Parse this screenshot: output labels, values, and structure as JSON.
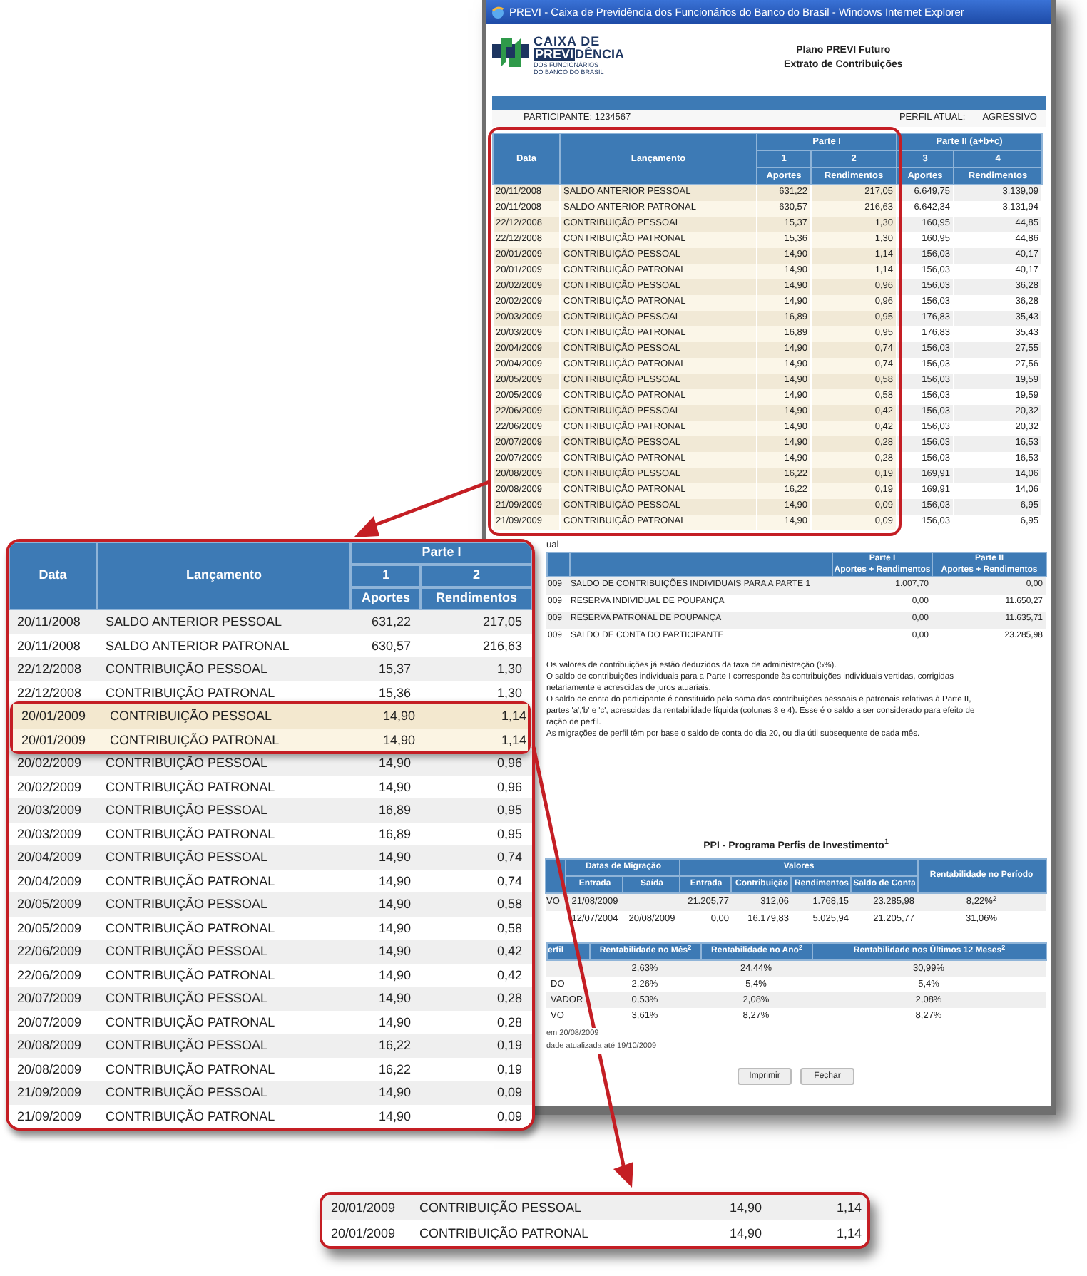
{
  "window": {
    "title": "PREVI - Caixa de Previdência dos Funcionários do Banco do Brasil - Windows Internet Explorer",
    "logo": {
      "line1": "CAIXA DE",
      "boxed": "PREVI",
      "rest": "DÊNCIA",
      "line3": "DOS FUNCIONÁRIOS",
      "line4": "DO BANCO DO BRASIL"
    },
    "heading": [
      "Plano PREVI Futuro",
      "Extrato de Contribuições"
    ],
    "participant": "PARTICIPANTE: 1234567",
    "profile_label": "PERFIL ATUAL:",
    "profile_value": "AGRESSIVO",
    "statement": {
      "headers": {
        "date": "Data",
        "entry": "Lançamento",
        "groups": [
          "Parte I",
          "Parte II (a+b+c)"
        ],
        "numbers": [
          "1",
          "2",
          "3",
          "4"
        ],
        "subs": [
          "Aportes",
          "Rendimentos",
          "Aportes",
          "Rendimentos"
        ]
      },
      "rows": [
        [
          "20/11/2008",
          "SALDO ANTERIOR PESSOAL",
          "631,22",
          "217,05",
          "6.649,75",
          "3.139,09"
        ],
        [
          "20/11/2008",
          "SALDO ANTERIOR PATRONAL",
          "630,57",
          "216,63",
          "6.642,34",
          "3.131,94"
        ],
        [
          "22/12/2008",
          "CONTRIBUIÇÃO PESSOAL",
          "15,37",
          "1,30",
          "160,95",
          "44,85"
        ],
        [
          "22/12/2008",
          "CONTRIBUIÇÃO PATRONAL",
          "15,36",
          "1,30",
          "160,95",
          "44,86"
        ],
        [
          "20/01/2009",
          "CONTRIBUIÇÃO PESSOAL",
          "14,90",
          "1,14",
          "156,03",
          "40,17"
        ],
        [
          "20/01/2009",
          "CONTRIBUIÇÃO PATRONAL",
          "14,90",
          "1,14",
          "156,03",
          "40,17"
        ],
        [
          "20/02/2009",
          "CONTRIBUIÇÃO PESSOAL",
          "14,90",
          "0,96",
          "156,03",
          "36,28"
        ],
        [
          "20/02/2009",
          "CONTRIBUIÇÃO PATRONAL",
          "14,90",
          "0,96",
          "156,03",
          "36,28"
        ],
        [
          "20/03/2009",
          "CONTRIBUIÇÃO PESSOAL",
          "16,89",
          "0,95",
          "176,83",
          "35,43"
        ],
        [
          "20/03/2009",
          "CONTRIBUIÇÃO PATRONAL",
          "16,89",
          "0,95",
          "176,83",
          "35,43"
        ],
        [
          "20/04/2009",
          "CONTRIBUIÇÃO PESSOAL",
          "14,90",
          "0,74",
          "156,03",
          "27,55"
        ],
        [
          "20/04/2009",
          "CONTRIBUIÇÃO PATRONAL",
          "14,90",
          "0,74",
          "156,03",
          "27,56"
        ],
        [
          "20/05/2009",
          "CONTRIBUIÇÃO PESSOAL",
          "14,90",
          "0,58",
          "156,03",
          "19,59"
        ],
        [
          "20/05/2009",
          "CONTRIBUIÇÃO PATRONAL",
          "14,90",
          "0,58",
          "156,03",
          "19,59"
        ],
        [
          "22/06/2009",
          "CONTRIBUIÇÃO PESSOAL",
          "14,90",
          "0,42",
          "156,03",
          "20,32"
        ],
        [
          "22/06/2009",
          "CONTRIBUIÇÃO PATRONAL",
          "14,90",
          "0,42",
          "156,03",
          "20,32"
        ],
        [
          "20/07/2009",
          "CONTRIBUIÇÃO PESSOAL",
          "14,90",
          "0,28",
          "156,03",
          "16,53"
        ],
        [
          "20/07/2009",
          "CONTRIBUIÇÃO PATRONAL",
          "14,90",
          "0,28",
          "156,03",
          "16,53"
        ],
        [
          "20/08/2009",
          "CONTRIBUIÇÃO PESSOAL",
          "16,22",
          "0,19",
          "169,91",
          "14,06"
        ],
        [
          "20/08/2009",
          "CONTRIBUIÇÃO PATRONAL",
          "16,22",
          "0,19",
          "169,91",
          "14,06"
        ],
        [
          "21/09/2009",
          "CONTRIBUIÇÃO PESSOAL",
          "14,90",
          "0,09",
          "156,03",
          "6,95"
        ],
        [
          "21/09/2009",
          "CONTRIBUIÇÃO PATRONAL",
          "14,90",
          "0,09",
          "156,03",
          "6,95"
        ]
      ]
    },
    "summary_label": "ual",
    "summary": {
      "part1": [
        "Parte I",
        "Aportes + Rendimentos"
      ],
      "part2": [
        "Parte II",
        "Aportes + Rendimentos"
      ],
      "rows": [
        [
          "009",
          "SALDO DE CONTRIBUIÇÕES INDIVIDUAIS PARA A PARTE 1",
          "1.007,70",
          "0,00"
        ],
        [
          "009",
          "RESERVA INDIVIDUAL DE POUPANÇA",
          "0,00",
          "11.650,27"
        ],
        [
          "009",
          "RESERVA PATRONAL DE POUPANÇA",
          "0,00",
          "11.635,71"
        ],
        [
          "009",
          "SALDO DE CONTA DO PARTICIPANTE",
          "0,00",
          "23.285,98"
        ]
      ]
    },
    "notes": [
      "Os valores de contribuições já estão deduzidos da taxa de administração (5%).",
      "O saldo de contribuições individuais para a Parte I corresponde às contribuições individuais vertidas, corrigidas",
      "netariamente e acrescidas de juros atuariais.",
      "O saldo de conta do participante é constituído pela soma das contribuições pessoais e patronais relativas à Parte II,",
      "partes 'a','b' e 'c', acrescidas da rentabilidade líquida (colunas 3 e 4). Esse é o saldo a ser considerado para efeito de",
      "ração de perfil.",
      "As migrações de perfil têm por base o saldo de conta do dia 20, ou dia útil subsequente de cada mês."
    ],
    "ppi": {
      "title": "PPI - Programa Perfis de Investimento$^{1}$",
      "dates_header": "Datas de Migração",
      "values_header": "Valores",
      "rent_header": "Rentabilidade no Período",
      "subs": [
        "Entrada",
        "Saída",
        "Entrada",
        "Contribuição",
        "Rendimentos",
        "Saldo de Conta"
      ],
      "rows": [
        {
          "profile": "VO",
          "entry_date": "21/08/2009",
          "entry": "21.205,77",
          "contribution": "312,06",
          "earnings": "1.768,15",
          "balance": "23.285,98",
          "rent": "8,22%$^{2}$"
        },
        {
          "entry_date": "12/07/2004",
          "exit_date": "20/08/2009",
          "entry": "0,00",
          "contribution": "16.179,83",
          "earnings": "5.025,94",
          "balance": "21.205,77",
          "rent": "31,06%"
        }
      ]
    },
    "profiles": {
      "headers": [
        "erfil",
        "Rentabilidade no Mês$^{2}$",
        "Rentabilidade no Ano$^{2}$",
        "Rentabilidade nos Últimos 12 Meses$^{2}$"
      ],
      "rows": [
        {
          "month": "2,63%",
          "year": "24,44%",
          "last12": "30,99%"
        },
        {
          "profile": "DO",
          "month": "2,26%",
          "year": "5,4%",
          "last12": "5,4%"
        },
        {
          "profile": "VADOR",
          "month": "0,53%",
          "year": "2,08%",
          "last12": "2,08%"
        },
        {
          "profile": "VO",
          "month": "3,61%",
          "year": "8,27%",
          "last12": "8,27%"
        }
      ]
    },
    "footnotes": [
      "em 20/08/2009",
      "dade atualizada até 19/10/2009"
    ],
    "buttons": [
      "Imprimir",
      "Fechar"
    ]
  },
  "zoom_callout": {
    "headers": {
      "date": "Data",
      "entry": "Lançamento",
      "group": "Parte I",
      "numbers": [
        "1",
        "2"
      ],
      "subs": [
        "Aportes",
        "Rendimentos"
      ]
    },
    "rows": [
      {
        "cells": [
          "20/11/2008",
          "SALDO ANTERIOR PESSOAL",
          "631,22",
          "217,05"
        ],
        "highlighted": false
      },
      {
        "cells": [
          "20/11/2008",
          "SALDO ANTERIOR PATRONAL",
          "630,57",
          "216,63"
        ],
        "highlighted": false
      },
      {
        "cells": [
          "22/12/2008",
          "CONTRIBUIÇÃO PESSOAL",
          "15,37",
          "1,30"
        ],
        "highlighted": false
      },
      {
        "cells": [
          "22/12/2008",
          "CONTRIBUIÇÃO PATRONAL",
          "15,36",
          "1,30"
        ],
        "highlighted": false
      },
      {
        "cells": [
          "20/01/2009",
          "CONTRIBUIÇÃO PESSOAL",
          "14,90",
          "1,14"
        ],
        "highlighted": true
      },
      {
        "cells": [
          "20/01/2009",
          "CONTRIBUIÇÃO PATRONAL",
          "14,90",
          "1,14"
        ],
        "highlighted": true
      },
      {
        "cells": [
          "20/02/2009",
          "CONTRIBUIÇÃO PESSOAL",
          "14,90",
          "0,96"
        ],
        "highlighted": false
      },
      {
        "cells": [
          "20/02/2009",
          "CONTRIBUIÇÃO PATRONAL",
          "14,90",
          "0,96"
        ],
        "highlighted": false
      },
      {
        "cells": [
          "20/03/2009",
          "CONTRIBUIÇÃO PESSOAL",
          "16,89",
          "0,95"
        ],
        "highlighted": false
      },
      {
        "cells": [
          "20/03/2009",
          "CONTRIBUIÇÃO PATRONAL",
          "16,89",
          "0,95"
        ],
        "highlighted": false
      },
      {
        "cells": [
          "20/04/2009",
          "CONTRIBUIÇÃO PESSOAL",
          "14,90",
          "0,74"
        ],
        "highlighted": false
      },
      {
        "cells": [
          "20/04/2009",
          "CONTRIBUIÇÃO PATRONAL",
          "14,90",
          "0,74"
        ],
        "highlighted": false
      },
      {
        "cells": [
          "20/05/2009",
          "CONTRIBUIÇÃO PESSOAL",
          "14,90",
          "0,58"
        ],
        "highlighted": false
      },
      {
        "cells": [
          "20/05/2009",
          "CONTRIBUIÇÃO PATRONAL",
          "14,90",
          "0,58"
        ],
        "highlighted": false
      },
      {
        "cells": [
          "22/06/2009",
          "CONTRIBUIÇÃO PESSOAL",
          "14,90",
          "0,42"
        ],
        "highlighted": false
      },
      {
        "cells": [
          "22/06/2009",
          "CONTRIBUIÇÃO PATRONAL",
          "14,90",
          "0,42"
        ],
        "highlighted": false
      },
      {
        "cells": [
          "20/07/2009",
          "CONTRIBUIÇÃO PESSOAL",
          "14,90",
          "0,28"
        ],
        "highlighted": false
      },
      {
        "cells": [
          "20/07/2009",
          "CONTRIBUIÇÃO PATRONAL",
          "14,90",
          "0,28"
        ],
        "highlighted": false
      },
      {
        "cells": [
          "20/08/2009",
          "CONTRIBUIÇÃO PESSOAL",
          "16,22",
          "0,19"
        ],
        "highlighted": false
      },
      {
        "cells": [
          "20/08/2009",
          "CONTRIBUIÇÃO PATRONAL",
          "16,22",
          "0,19"
        ],
        "highlighted": false
      },
      {
        "cells": [
          "21/09/2009",
          "CONTRIBUIÇÃO PESSOAL",
          "14,90",
          "0,09"
        ],
        "highlighted": false
      },
      {
        "cells": [
          "21/09/2009",
          "CONTRIBUIÇÃO PATRONAL",
          "14,90",
          "0,09"
        ],
        "highlighted": false
      }
    ]
  },
  "detail_callout": {
    "rows": [
      [
        "20/01/2009",
        "CONTRIBUIÇÃO PESSOAL",
        "14,90",
        "1,14"
      ],
      [
        "20/01/2009",
        "CONTRIBUIÇÃO PATRONAL",
        "14,90",
        "1,14"
      ]
    ]
  }
}
